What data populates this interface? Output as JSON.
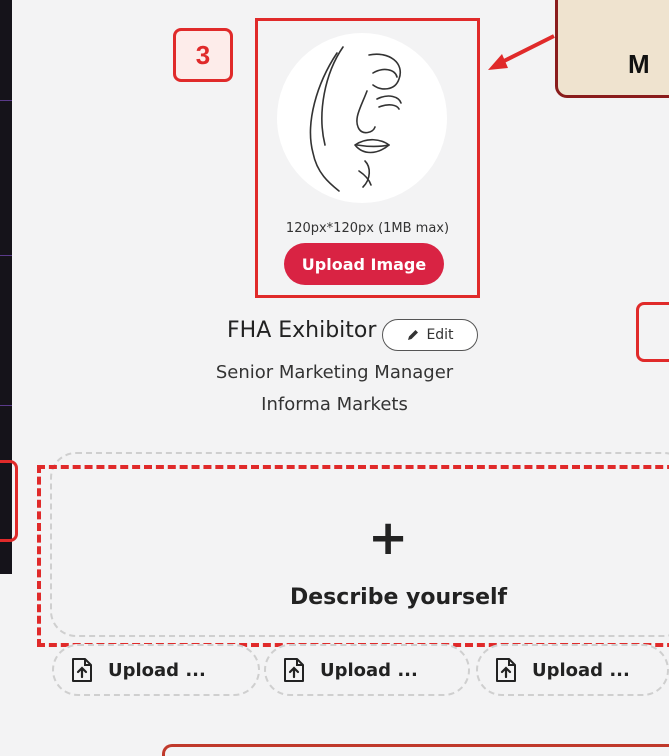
{
  "annotation": {
    "step_number": "3",
    "tip_text_fragment": "M"
  },
  "profile_photo": {
    "size_note": "120px*120px (1MB max)",
    "upload_button_label": "Upload Image"
  },
  "profile": {
    "name": "FHA Exhibitor",
    "edit_label": "Edit",
    "role": "Senior Marketing Manager",
    "company": "Informa Markets"
  },
  "describe_card": {
    "icon": "plus-icon",
    "label": "Describe yourself"
  },
  "upload_chips": [
    {
      "icon": "file-upload-icon",
      "label": "Upload ..."
    },
    {
      "icon": "file-upload-icon",
      "label": "Upload ..."
    },
    {
      "icon": "file-upload-icon",
      "label": "Upload ..."
    }
  ],
  "colors": {
    "annotation_red": "#e02a2a",
    "primary_button": "#d92343",
    "tip_background": "#efe3cf"
  }
}
